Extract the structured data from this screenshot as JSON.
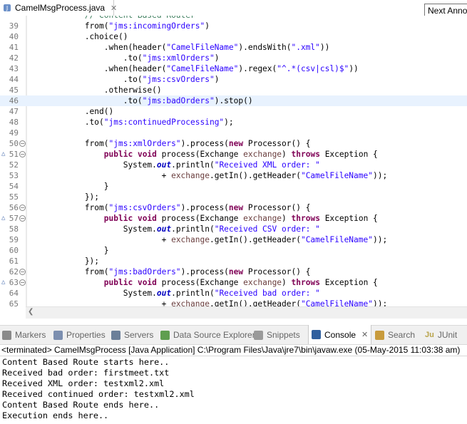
{
  "editor_tab": {
    "title": "CamelMsgProcess.java",
    "close": "✕"
  },
  "tooltip": "Next Anno",
  "code_lines": [
    {
      "n": "",
      "tokens": [
        {
          "t": "            ",
          "c": ""
        },
        {
          "t": "// Content Based Router",
          "c": "c"
        }
      ]
    },
    {
      "n": "39",
      "tokens": [
        {
          "t": "            from(",
          "c": ""
        },
        {
          "t": "\"jms:incomingOrders\"",
          "c": "s"
        },
        {
          "t": ")",
          "c": ""
        }
      ]
    },
    {
      "n": "40",
      "tokens": [
        {
          "t": "            .choice()",
          "c": ""
        }
      ]
    },
    {
      "n": "41",
      "tokens": [
        {
          "t": "                .when(header(",
          "c": ""
        },
        {
          "t": "\"CamelFileName\"",
          "c": "s"
        },
        {
          "t": ").endsWith(",
          "c": ""
        },
        {
          "t": "\".xml\"",
          "c": "s"
        },
        {
          "t": "))",
          "c": ""
        }
      ]
    },
    {
      "n": "42",
      "tokens": [
        {
          "t": "                    .to(",
          "c": ""
        },
        {
          "t": "\"jms:xmlOrders\"",
          "c": "s"
        },
        {
          "t": ")",
          "c": ""
        }
      ]
    },
    {
      "n": "43",
      "tokens": [
        {
          "t": "                .when(header(",
          "c": ""
        },
        {
          "t": "\"CamelFileName\"",
          "c": "s"
        },
        {
          "t": ").regex(",
          "c": ""
        },
        {
          "t": "\"^.*(csv|csl)$\"",
          "c": "s"
        },
        {
          "t": "))",
          "c": ""
        }
      ]
    },
    {
      "n": "44",
      "tokens": [
        {
          "t": "                    .to(",
          "c": ""
        },
        {
          "t": "\"jms:csvOrders\"",
          "c": "s"
        },
        {
          "t": ")",
          "c": ""
        }
      ]
    },
    {
      "n": "45",
      "tokens": [
        {
          "t": "                .otherwise()",
          "c": ""
        }
      ]
    },
    {
      "n": "46",
      "cur": true,
      "tokens": [
        {
          "t": "                    .to(",
          "c": ""
        },
        {
          "t": "\"jms:badOrders\"",
          "c": "s"
        },
        {
          "t": ").stop()",
          "c": ""
        }
      ]
    },
    {
      "n": "47",
      "tokens": [
        {
          "t": "            .end()",
          "c": ""
        }
      ]
    },
    {
      "n": "48",
      "tokens": [
        {
          "t": "            .to(",
          "c": ""
        },
        {
          "t": "\"jms:continuedProcessing\"",
          "c": "s"
        },
        {
          "t": ");",
          "c": ""
        }
      ]
    },
    {
      "n": "49",
      "tokens": []
    },
    {
      "n": "50",
      "fold": "−",
      "tokens": [
        {
          "t": "            from(",
          "c": ""
        },
        {
          "t": "\"jms:xmlOrders\"",
          "c": "s"
        },
        {
          "t": ").process(",
          "c": ""
        },
        {
          "t": "new",
          "c": "k"
        },
        {
          "t": " Processor() {",
          "c": ""
        }
      ]
    },
    {
      "n": "51",
      "mark": "△",
      "fold": "−",
      "tokens": [
        {
          "t": "                ",
          "c": ""
        },
        {
          "t": "public",
          "c": "k"
        },
        {
          "t": " ",
          "c": ""
        },
        {
          "t": "void",
          "c": "k"
        },
        {
          "t": " process(Exchange ",
          "c": ""
        },
        {
          "t": "exchange",
          "c": "v"
        },
        {
          "t": ") ",
          "c": ""
        },
        {
          "t": "throws",
          "c": "k"
        },
        {
          "t": " Exception {",
          "c": ""
        }
      ]
    },
    {
      "n": "52",
      "tokens": [
        {
          "t": "                    System.",
          "c": ""
        },
        {
          "t": "out",
          "c": "f"
        },
        {
          "t": ".println(",
          "c": ""
        },
        {
          "t": "\"Received XML order: \"",
          "c": "s"
        }
      ]
    },
    {
      "n": "53",
      "tokens": [
        {
          "t": "                            + ",
          "c": ""
        },
        {
          "t": "exchange",
          "c": "v"
        },
        {
          "t": ".getIn().getHeader(",
          "c": ""
        },
        {
          "t": "\"CamelFileName\"",
          "c": "s"
        },
        {
          "t": "));",
          "c": ""
        }
      ]
    },
    {
      "n": "54",
      "tokens": [
        {
          "t": "                }",
          "c": ""
        }
      ]
    },
    {
      "n": "55",
      "tokens": [
        {
          "t": "            });",
          "c": ""
        }
      ]
    },
    {
      "n": "56",
      "fold": "−",
      "tokens": [
        {
          "t": "            from(",
          "c": ""
        },
        {
          "t": "\"jms:csvOrders\"",
          "c": "s"
        },
        {
          "t": ").process(",
          "c": ""
        },
        {
          "t": "new",
          "c": "k"
        },
        {
          "t": " Processor() {",
          "c": ""
        }
      ]
    },
    {
      "n": "57",
      "mark": "△",
      "fold": "−",
      "tokens": [
        {
          "t": "                ",
          "c": ""
        },
        {
          "t": "public",
          "c": "k"
        },
        {
          "t": " ",
          "c": ""
        },
        {
          "t": "void",
          "c": "k"
        },
        {
          "t": " process(Exchange ",
          "c": ""
        },
        {
          "t": "exchange",
          "c": "v"
        },
        {
          "t": ") ",
          "c": ""
        },
        {
          "t": "throws",
          "c": "k"
        },
        {
          "t": " Exception {",
          "c": ""
        }
      ]
    },
    {
      "n": "58",
      "tokens": [
        {
          "t": "                    System.",
          "c": ""
        },
        {
          "t": "out",
          "c": "f"
        },
        {
          "t": ".println(",
          "c": ""
        },
        {
          "t": "\"Received CSV order: \"",
          "c": "s"
        }
      ]
    },
    {
      "n": "59",
      "tokens": [
        {
          "t": "                            + ",
          "c": ""
        },
        {
          "t": "exchange",
          "c": "v"
        },
        {
          "t": ".getIn().getHeader(",
          "c": ""
        },
        {
          "t": "\"CamelFileName\"",
          "c": "s"
        },
        {
          "t": "));",
          "c": ""
        }
      ]
    },
    {
      "n": "60",
      "tokens": [
        {
          "t": "                }",
          "c": ""
        }
      ]
    },
    {
      "n": "61",
      "tokens": [
        {
          "t": "            });",
          "c": ""
        }
      ]
    },
    {
      "n": "62",
      "fold": "−",
      "tokens": [
        {
          "t": "            from(",
          "c": ""
        },
        {
          "t": "\"jms:badOrders\"",
          "c": "s"
        },
        {
          "t": ").process(",
          "c": ""
        },
        {
          "t": "new",
          "c": "k"
        },
        {
          "t": " Processor() {",
          "c": ""
        }
      ]
    },
    {
      "n": "63",
      "mark": "△",
      "fold": "−",
      "tokens": [
        {
          "t": "                ",
          "c": ""
        },
        {
          "t": "public",
          "c": "k"
        },
        {
          "t": " ",
          "c": ""
        },
        {
          "t": "void",
          "c": "k"
        },
        {
          "t": " process(Exchange ",
          "c": ""
        },
        {
          "t": "exchange",
          "c": "v"
        },
        {
          "t": ") ",
          "c": ""
        },
        {
          "t": "throws",
          "c": "k"
        },
        {
          "t": " Exception {",
          "c": ""
        }
      ]
    },
    {
      "n": "64",
      "tokens": [
        {
          "t": "                    System.",
          "c": ""
        },
        {
          "t": "out",
          "c": "f"
        },
        {
          "t": ".println(",
          "c": ""
        },
        {
          "t": "\"Received bad order: \"",
          "c": "s"
        }
      ]
    },
    {
      "n": "65",
      "tokens": [
        {
          "t": "                            + ",
          "c": ""
        },
        {
          "t": "exchange",
          "c": "v"
        },
        {
          "t": ".getIn().getHeader(",
          "c": ""
        },
        {
          "t": "\"CamelFileName\"",
          "c": "s"
        },
        {
          "t": "));",
          "c": ""
        }
      ]
    }
  ],
  "view_tabs": [
    {
      "label": "Markers",
      "icon": "markers-icon",
      "color": "#8a8a8a"
    },
    {
      "label": "Properties",
      "icon": "properties-icon",
      "color": "#7c8fb0"
    },
    {
      "label": "Servers",
      "icon": "servers-icon",
      "color": "#6b7f99"
    },
    {
      "label": "Data Source Explorer",
      "icon": "data-source-explorer-icon",
      "color": "#5f9e4f"
    },
    {
      "label": "Snippets",
      "icon": "snippets-icon",
      "color": "#9a9a9a"
    },
    {
      "label": "Console",
      "icon": "console-icon",
      "color": "#2f5f9e",
      "active": true,
      "close": "✕"
    },
    {
      "label": "Search",
      "icon": "search-icon",
      "color": "#c89b3c"
    },
    {
      "label": "JUnit",
      "icon": "junit-icon",
      "color": "#b8a34a",
      "prefix": "Ju"
    }
  ],
  "console": {
    "header": "<terminated> CamelMsgProcess [Java Application] C:\\Program Files\\Java\\jre7\\bin\\javaw.exe (05-May-2015 11:03:38 am)",
    "lines": [
      "Content Based Route starts here..",
      "Received bad order: firstmeet.txt",
      "Received XML order: testxml2.xml",
      "Received continued order: testxml2.xml",
      "Content Based Route ends here..",
      "Execution ends here.."
    ]
  }
}
